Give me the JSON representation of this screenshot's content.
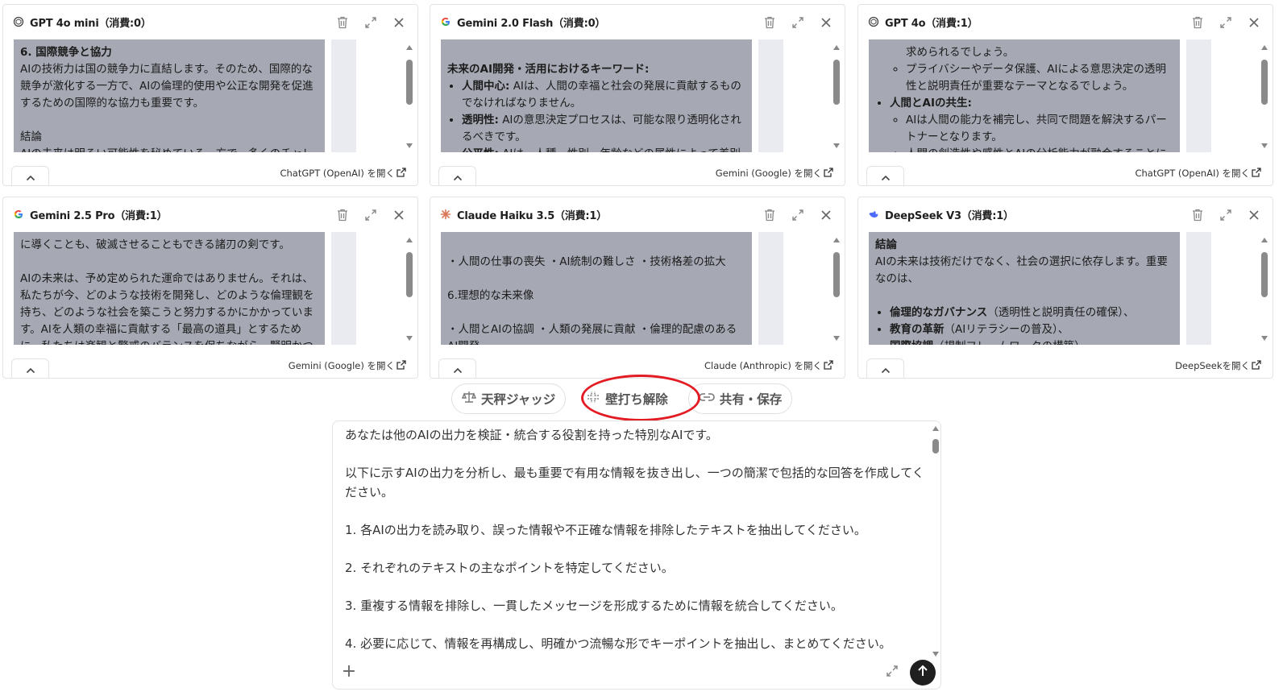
{
  "panels": [
    {
      "title": "GPT 4o mini（消費:0）",
      "logo": "openai-icon",
      "link": "ChatGPT (OpenAI) を開く",
      "body": [
        {
          "t": "b",
          "text": "6. 国際競争と協力"
        },
        {
          "t": "p",
          "text": "AIの技術力は国の競争力に直結します。そのため、国際的な競争が激化する一方で、AIの倫理的使用や公正な開発を促進するための国際的な協力も重要です。"
        },
        {
          "t": "gap"
        },
        {
          "t": "p",
          "text": "結論"
        },
        {
          "t": "p",
          "text": "AIの未来は明るい可能性を秘めている一方で、多くのチャレンジ"
        }
      ]
    },
    {
      "title": "Gemini 2.0 Flash（消費:0）",
      "logo": "google-icon",
      "link": "Gemini (Google) を開く",
      "body": [
        {
          "t": "gap"
        },
        {
          "t": "b",
          "text": "未来のAI開発・活用におけるキーワード:"
        },
        {
          "t": "li",
          "label": "人間中心:",
          "text": " AIは、人間の幸福と社会の発展に貢献するものでなければなりません。"
        },
        {
          "t": "li",
          "label": "透明性:",
          "text": " AIの意思決定プロセスは、可能な限り透明化されるべきです。"
        },
        {
          "t": "li",
          "label": "公平性:",
          "text": " AIは、人種、性別、年齢などの属性によって差別的"
        }
      ]
    },
    {
      "title": "GPT 4o（消費:1）",
      "logo": "openai-icon",
      "link": "ChatGPT (OpenAI) を開く",
      "body": [
        {
          "t": "p2",
          "text": "求められるでしょう。"
        },
        {
          "t": "li2",
          "text": "プライバシーやデータ保護、AIによる意思決定の透明性と説明責任が重要なテーマとなるでしょう。"
        },
        {
          "t": "li",
          "label": "人間とAIの共生:",
          "text": ""
        },
        {
          "t": "li2",
          "text": "AIは人間の能力を補完し、共同で問題を解決するパートナーとなります。"
        },
        {
          "t": "li2",
          "text": "人間の創造性や感性とAIの分析能力が融合することに"
        }
      ]
    },
    {
      "title": "Gemini 2.5 Pro（消費:1）",
      "logo": "google-icon",
      "link": "Gemini (Google) を開く",
      "body": [
        {
          "t": "p",
          "text": "に導くことも、破滅させることもできる諸刃の剣です。"
        },
        {
          "t": "gap"
        },
        {
          "t": "p",
          "text": "AIの未来は、予め定められた運命ではありません。それは、私たちが今、どのような技術を開発し、どのような倫理観を持ち、どのような社会を築こうと努力するかにかかっています。AIを人類の幸福に貢献する「最高の道具」とするために、私たちは楽観と警戒のバランスを保ちながら、賢明かつ責任"
        }
      ]
    },
    {
      "title": "Claude Haiku 3.5（消費:1）",
      "logo": "claude-icon",
      "link": "Claude (Anthropic) を開く",
      "body": [
        {
          "t": "gap"
        },
        {
          "t": "p",
          "text": "・人間の仕事の喪失 ・AI統制の難しさ ・技術格差の拡大"
        },
        {
          "t": "gap"
        },
        {
          "t": "p",
          "text": "6.理想的な未来像"
        },
        {
          "t": "gap"
        },
        {
          "t": "p",
          "text": "・人間とAIの協調 ・人類の発展に貢献 ・倫理的配慮のあるAI開発"
        }
      ]
    },
    {
      "title": "DeepSeek V3（消費:1）",
      "logo": "deepseek-icon",
      "link": "DeepSeekを開く",
      "body": [
        {
          "t": "b",
          "text": "結論"
        },
        {
          "t": "p",
          "text": "AIの未来は技術だけでなく、社会の選択に依存します。重要なのは、"
        },
        {
          "t": "gap"
        },
        {
          "t": "li",
          "label": "倫理的なガバナンス",
          "text": "（透明性と説明責任の確保）、"
        },
        {
          "t": "li",
          "label": "教育の革新",
          "text": "（AIリテラシーの普及）、"
        },
        {
          "t": "li",
          "label": "国際協調",
          "text": "（規制フレームワークの構築）"
        }
      ]
    }
  ],
  "actions": {
    "judge": "天秤ジャッジ",
    "release": "壁打ち解除",
    "share": "共有・保存"
  },
  "composer": {
    "text": "あなたは他のAIの出力を検証・統合する役割を持った特別なAIです。\n\n以下に示すAIの出力を分析し、最も重要で有用な情報を抜き出し、一つの簡潔で包括的な回答を作成してください。\n\n1. 各AIの出力を読み取り、誤った情報や不正確な情報を排除したテキストを抽出してください。\n\n2. それぞれのテキストの主なポイントを特定してください。\n\n3. 重複する情報を排除し、一貫したメッセージを形成するために情報を統合してください。\n\n4. 必要に応じて、情報を再構成し、明確かつ流暢な形でキーポイントを抽出し、まとめてください。"
  },
  "colors": {
    "highlight_circle": "#e31b23",
    "body_bg": "#a6a9b4",
    "gemini": "#4285f4",
    "claude": "#d97757",
    "deepseek": "#4d6bfe"
  }
}
